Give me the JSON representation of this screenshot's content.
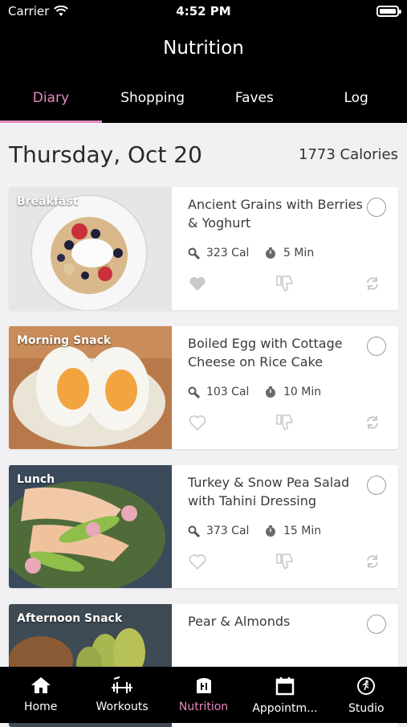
{
  "status_bar": {
    "carrier": "Carrier",
    "time": "4:52 PM"
  },
  "header": {
    "title": "Nutrition"
  },
  "tabs": [
    {
      "label": "Diary",
      "active": true
    },
    {
      "label": "Shopping",
      "active": false
    },
    {
      "label": "Faves",
      "active": false
    },
    {
      "label": "Log",
      "active": false
    }
  ],
  "diary": {
    "date": "Thursday, Oct 20",
    "calories": "1773 Calories",
    "meals": [
      {
        "meal_type": "Breakfast",
        "title": "Ancient Grains with Berries & Yoghurt",
        "calories": "323 Cal",
        "time": "5 Min",
        "favorited": true
      },
      {
        "meal_type": "Morning Snack",
        "title": "Boiled Egg with Cottage Cheese on Rice Cake",
        "calories": "103 Cal",
        "time": "10 Min",
        "favorited": false
      },
      {
        "meal_type": "Lunch",
        "title": "Turkey & Snow Pea Salad with Tahini Dressing",
        "calories": "373 Cal",
        "time": "15 Min",
        "favorited": false
      },
      {
        "meal_type": "Afternoon Snack",
        "title": "Pear & Almonds",
        "calories": "",
        "time": "",
        "favorited": false
      }
    ]
  },
  "tab_bar": [
    {
      "label": "Home",
      "icon": "home-icon"
    },
    {
      "label": "Workouts",
      "icon": "dumbbell-icon"
    },
    {
      "label": "Nutrition",
      "icon": "nutrition-icon",
      "active": true
    },
    {
      "label": "Appointm...",
      "icon": "calendar-icon"
    },
    {
      "label": "Studio",
      "icon": "studio-icon"
    }
  ],
  "colors": {
    "accent": "#e38ac0",
    "header_bg": "#000000",
    "page_bg": "#f1f1f3"
  }
}
